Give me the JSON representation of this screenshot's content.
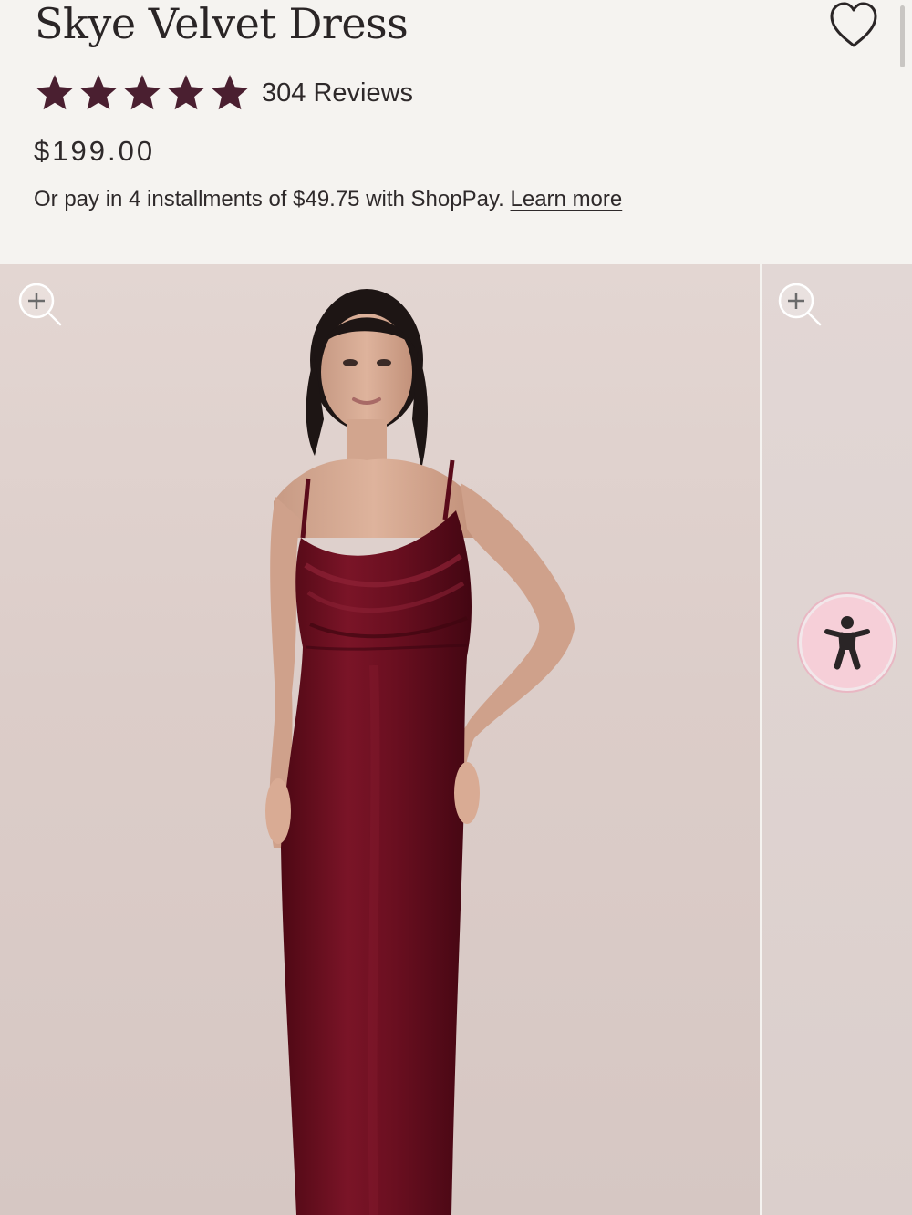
{
  "product": {
    "title": "Skye Velvet Dress",
    "rating": 5,
    "rating_max": 5,
    "reviews_label": "304 Reviews",
    "price": "$199.00",
    "installments_text": "Or pay in 4 installments of $49.75 with ShopPay.",
    "learn_more_label": "Learn more"
  },
  "gallery": {
    "images": [
      {
        "alt": "Model wearing burgundy velvet slip dress"
      },
      {
        "alt": "Next product image"
      }
    ],
    "zoom_icon": "zoom-in-icon"
  },
  "icons": {
    "wishlist": "heart-outline-icon",
    "accessibility": "accessibility-person-icon"
  },
  "colors": {
    "star": "#4a1f30",
    "text": "#2e292a",
    "background": "#f5f3f0",
    "dress": "#6b0f22",
    "accessibility_button": "#f6cfd8"
  }
}
